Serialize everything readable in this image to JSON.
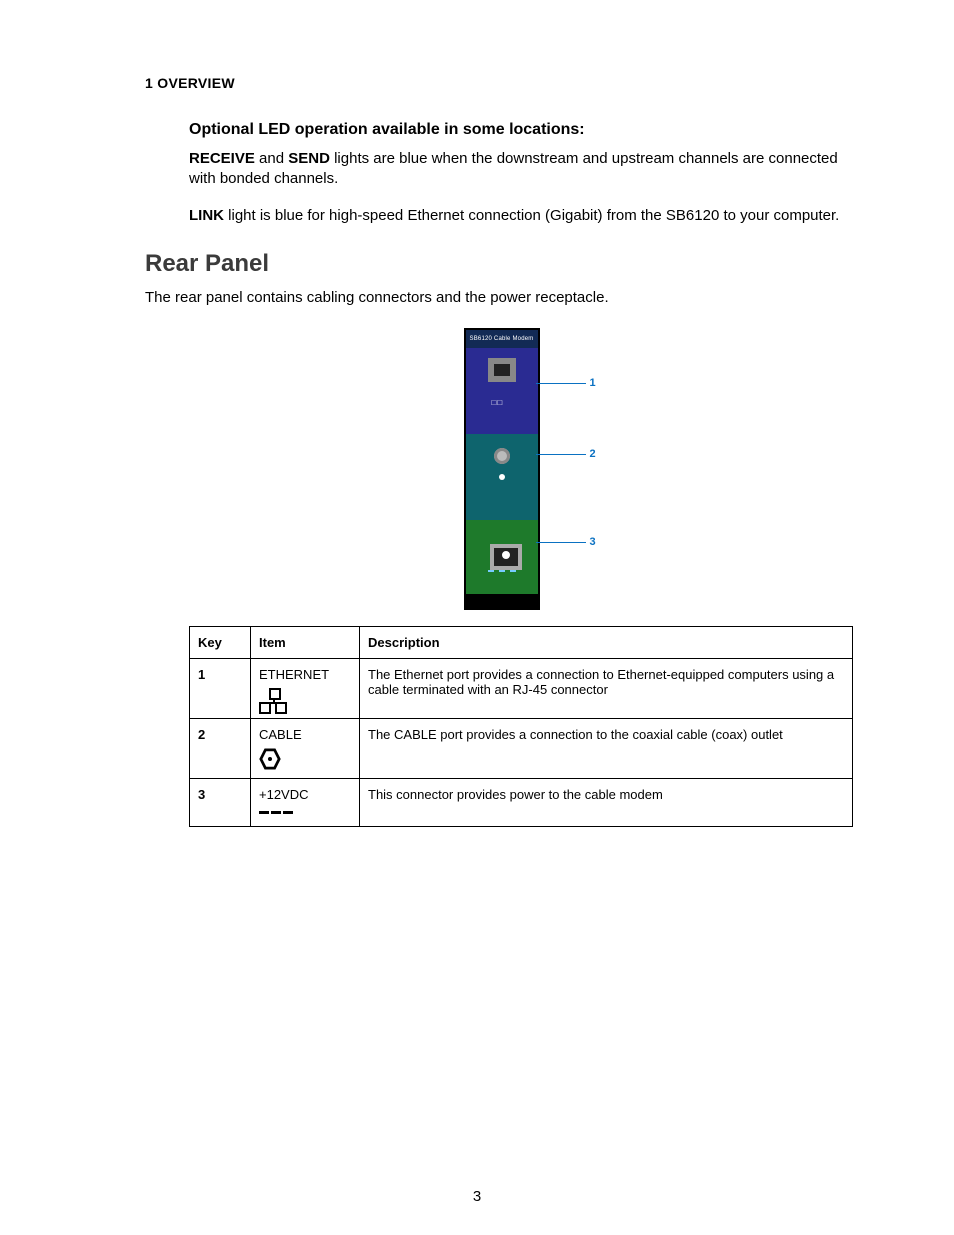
{
  "header": {
    "chapter": "1 OVERVIEW"
  },
  "led": {
    "subhead": "Optional LED operation available in some locations:",
    "p1_bold1": "RECEIVE",
    "p1_mid": " and ",
    "p1_bold2": "SEND",
    "p1_rest": " lights are blue when the downstream and upstream channels are connected with bonded channels.",
    "p2_bold": "LINK",
    "p2_rest": " light is blue for high-speed Ethernet connection (Gigabit) from the SB6120 to your computer."
  },
  "section": {
    "title": "Rear Panel",
    "intro": "The rear panel contains cabling connectors and the power receptacle."
  },
  "diagram": {
    "device_label": "SB6120 Cable Modem",
    "callouts": {
      "c1": "1",
      "c2": "2",
      "c3": "3"
    }
  },
  "table": {
    "headers": {
      "key": "Key",
      "item": "Item",
      "desc": "Description"
    },
    "rows": [
      {
        "key": "1",
        "item": "ETHERNET",
        "icon": "ethernet-icon",
        "desc": "The Ethernet port provides a connection to Ethernet-equipped computers using a cable terminated with an RJ-45 connector"
      },
      {
        "key": "2",
        "item": "CABLE",
        "icon": "coax-icon",
        "desc": "The CABLE port provides a connection to the coaxial cable (coax) outlet"
      },
      {
        "key": "3",
        "item": "+12VDC",
        "icon": "power-icon",
        "desc": "This connector provides power to the cable modem"
      }
    ]
  },
  "page_number": "3"
}
